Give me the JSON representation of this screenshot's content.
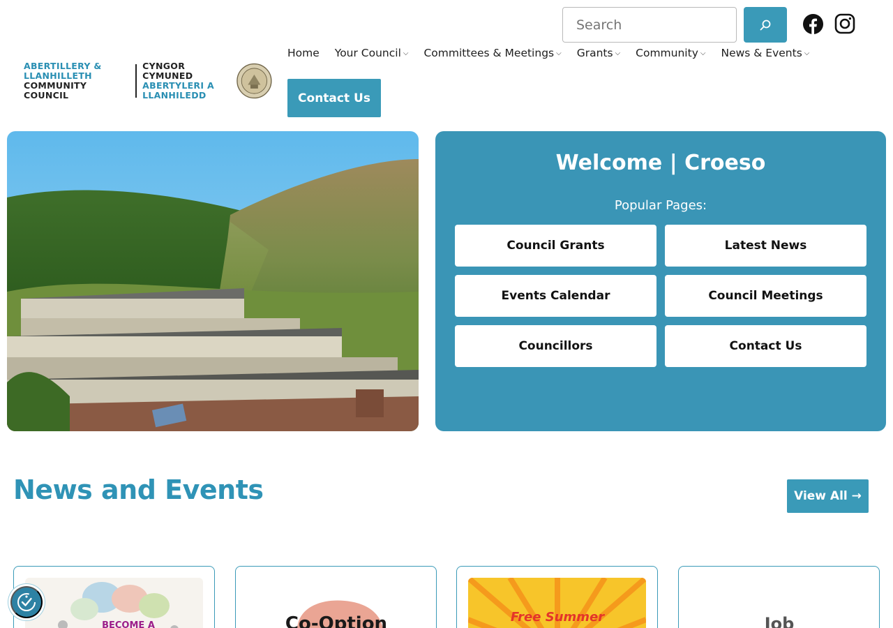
{
  "logo": {
    "en_line1": "ABERTILLERY &",
    "en_line2": "LLANHILLETH",
    "en_line3": "COMMUNITY COUNCIL",
    "cy_line1": "CYNGOR CYMUNED",
    "cy_line2": "ABERTYLERI A",
    "cy_line3": "LLANHILEDD"
  },
  "search": {
    "placeholder": "Search"
  },
  "social": {
    "facebook_icon": "facebook-icon",
    "instagram_icon": "instagram-icon"
  },
  "nav": {
    "items": [
      {
        "label": "Home",
        "has_submenu": false
      },
      {
        "label": "Your Council",
        "has_submenu": true
      },
      {
        "label": "Committees & Meetings",
        "has_submenu": true
      },
      {
        "label": "Grants",
        "has_submenu": true
      },
      {
        "label": "Community",
        "has_submenu": true
      },
      {
        "label": "News & Events",
        "has_submenu": true
      }
    ],
    "chevron": "⌵",
    "contact_label": "Contact Us"
  },
  "welcome": {
    "title": "Welcome | Croeso",
    "popular_label": "Popular Pages:",
    "buttons": [
      "Council Grants",
      "Latest News",
      "Events Calendar",
      "Council Meetings",
      "Councillors",
      "Contact Us"
    ]
  },
  "news": {
    "title": "News and Events",
    "view_all": "View All →",
    "cards": [
      {
        "image_text": "BECOME A"
      },
      {
        "image_text": "Co-Option"
      },
      {
        "image_text": "Free Summer"
      },
      {
        "image_text": "Job"
      }
    ]
  },
  "colors": {
    "accent": "#3a9ab8",
    "panel": "#3a95b6",
    "heading": "#2f93b6"
  }
}
